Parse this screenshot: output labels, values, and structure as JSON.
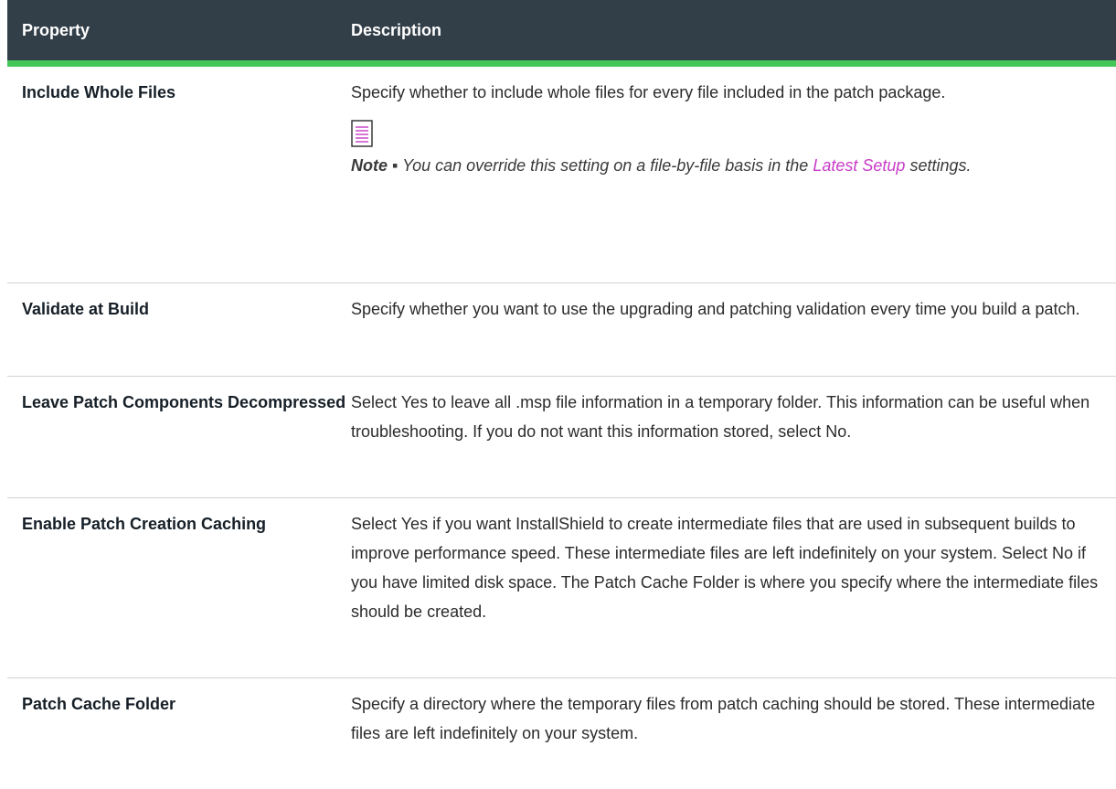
{
  "table": {
    "header": {
      "property": "Property",
      "description": "Description"
    },
    "rows": [
      {
        "property": "Include Whole Files",
        "description": "Specify whether to include whole files for every file included in the patch package.",
        "note": {
          "icon": "note-icon",
          "label": "Note ▪",
          "text_before": "You can override this setting on a file-by-file basis in the",
          "link": "Latest Setup",
          "text_after": "settings."
        }
      },
      {
        "property": "Validate at Build",
        "description": "Specify whether you want to use the upgrading and patching validation every time you build a patch."
      },
      {
        "property": "Leave Patch Components Decompressed",
        "description": "Select Yes to leave all .msp file information in a temporary folder. This information can be useful when troubleshooting. If you do not want this information stored, select No."
      },
      {
        "property": "Enable Patch Creation Caching",
        "description": "Select Yes if you want InstallShield to create intermediate files that are used in subsequent builds to improve performance speed. These intermediate files are left indefinitely on your system. Select No if you have limited disk space. The Patch Cache Folder is where you specify where the intermediate files should be created."
      },
      {
        "property": "Patch Cache Folder",
        "description": "Specify a directory where the temporary files from patch caching should be stored. These intermediate files are left indefinitely on your system."
      }
    ]
  },
  "colors": {
    "header_bg": "#323e48",
    "header_accent": "#44c659",
    "link": "#c83cc8",
    "row_divider": "#cfd3d6"
  }
}
